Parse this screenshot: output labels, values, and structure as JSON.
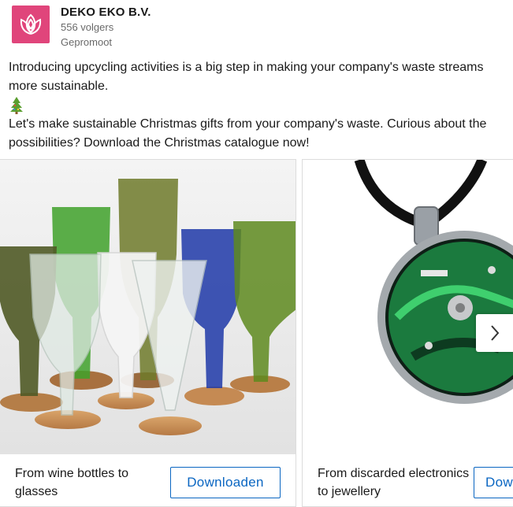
{
  "company": {
    "name": "DEKO EKO B.V.",
    "followers": "556 volgers",
    "promoted": "Gepromoot"
  },
  "post": {
    "paragraph1": "Introducing upcycling activities is a big step in making your company's waste streams more sustainable.",
    "paragraph2": "Let's make sustainable Christmas gifts from your company's waste. Curious about the possibilities? Download the Christmas catalogue now!"
  },
  "cards": [
    {
      "title": "From wine bottles to glasses",
      "button": "Downloaden",
      "image": "upcycled-wine-bottle-glasses"
    },
    {
      "title": "From discarded electronics to jewellery",
      "button": "Downloaden",
      "image": "circuit-board-pendant"
    }
  ],
  "icons": {
    "logo": "tulip-logo-icon",
    "emoji": "christmas-tree-icon",
    "next": "chevron-right-icon"
  },
  "colors": {
    "brand": "#e0457b",
    "button": "#0a66c2"
  }
}
